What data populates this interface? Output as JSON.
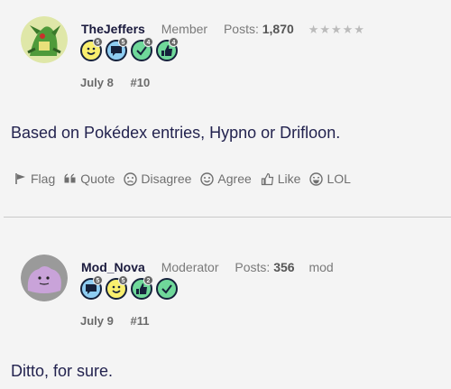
{
  "posts": [
    {
      "username": "TheJeffers",
      "role": "Member",
      "posts_label": "Posts:",
      "posts_count": "1,870",
      "stars": "★★★★★",
      "badges": [
        {
          "icon": "smile-badge-icon",
          "count": "5"
        },
        {
          "icon": "speech-bubble-badge-icon",
          "count": "5"
        },
        {
          "icon": "checkmark-badge-icon",
          "count": "4"
        },
        {
          "icon": "thumbs-up-badge-icon",
          "count": "4"
        }
      ],
      "date": "July 8",
      "number": "#10",
      "message": "Based on Pokédex entries, Hypno or Drifloon.",
      "actions": {
        "flag": "Flag",
        "quote": "Quote",
        "disagree": "Disagree",
        "agree": "Agree",
        "like": "Like",
        "lol": "LOL"
      }
    },
    {
      "username": "Mod_Nova",
      "role": "Moderator",
      "posts_label": "Posts:",
      "posts_count": "356",
      "extra": "mod",
      "badges": [
        {
          "icon": "speech-bubble-badge-icon",
          "count": "5"
        },
        {
          "icon": "smile-badge-icon",
          "count": "5"
        },
        {
          "icon": "thumbs-up-badge-icon",
          "count": "2"
        },
        {
          "icon": "checkmark-badge-icon",
          "count": ""
        }
      ],
      "date": "July 9",
      "number": "#11",
      "message": "Ditto, for sure."
    }
  ],
  "colors": {
    "background": "#f4f4f4",
    "text": "#23234f",
    "badge_yellow": "#f9ef6e",
    "badge_blue": "#8ecdf2",
    "badge_green": "#6fd89a"
  }
}
